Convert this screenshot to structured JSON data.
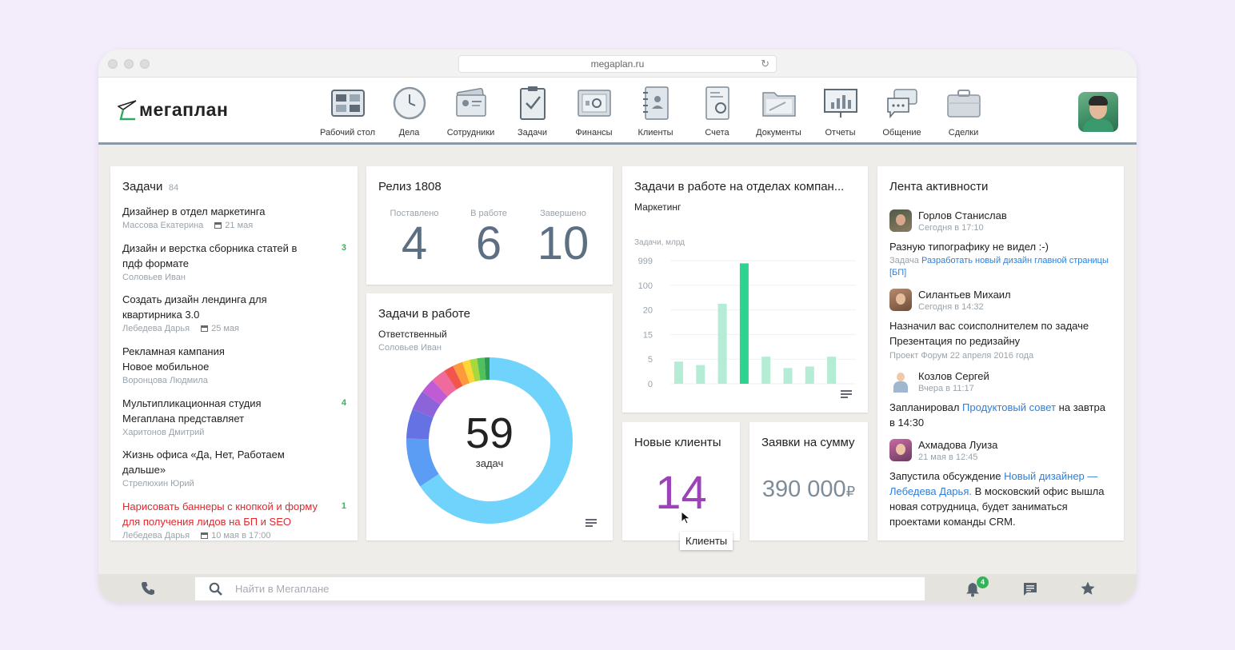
{
  "browser": {
    "url": "megaplan.ru"
  },
  "app": {
    "logo_text": "мегаплан",
    "brand_color": "#2ea866"
  },
  "nav": [
    {
      "label": "Рабочий стол",
      "icon": "desktop-icon"
    },
    {
      "label": "Дела",
      "icon": "clock-icon"
    },
    {
      "label": "Сотрудники",
      "icon": "employees-icon"
    },
    {
      "label": "Задачи",
      "icon": "task-clipboard-icon"
    },
    {
      "label": "Финансы",
      "icon": "safe-icon"
    },
    {
      "label": "Клиенты",
      "icon": "client-notebook-icon"
    },
    {
      "label": "Счета",
      "icon": "invoice-icon"
    },
    {
      "label": "Документы",
      "icon": "folder-icon"
    },
    {
      "label": "Отчеты",
      "icon": "report-board-icon"
    },
    {
      "label": "Общение",
      "icon": "chat-bubbles-icon"
    },
    {
      "label": "Сделки",
      "icon": "briefcase-icon"
    }
  ],
  "tasks": {
    "title": "Задачи",
    "count": "84",
    "items": [
      {
        "title": "Дизайнер в отдел маркетинга",
        "person": "Массова Екатерина",
        "date": "21 мая",
        "counter": ""
      },
      {
        "title": "Дизайн и верстка сборника статей в пдф формате",
        "person": "Соловьев Иван",
        "date": "",
        "counter": "3"
      },
      {
        "title": "Создать дизайн лендинга для квартирника 3.0",
        "person": "Лебедева Дарья",
        "date": "25 мая",
        "counter": ""
      },
      {
        "title": "Рекламная кампания Новое мобильное",
        "person": "Воронцова Людмила",
        "date": "",
        "counter": ""
      },
      {
        "title": "Мультипликационная студия Мегаплана представляет",
        "person": "Харитонов Дмитрий",
        "date": "",
        "counter": "4"
      },
      {
        "title": "Жизнь офиса «Да, Нет, Работаем дальше»",
        "person": "Стрелюхин Юрий",
        "date": "",
        "counter": ""
      },
      {
        "title": "Нарисовать баннеры с кнопкой и форму для получения лидов на БП и SEO",
        "person": "Лебедева Дарья",
        "date": "10 мая в 17:00",
        "counter": "1",
        "overdue": true
      }
    ]
  },
  "release": {
    "title": "Релиз 1808",
    "stats": [
      {
        "label": "Поставлено",
        "value": "4"
      },
      {
        "label": "В работе",
        "value": "6"
      },
      {
        "label": "Завершено",
        "value": "10"
      }
    ]
  },
  "in_progress": {
    "title": "Задачи в работе",
    "subtitle": "Ответственный",
    "person": "Соловьев Иван",
    "total": "59",
    "total_label": "задач"
  },
  "departments": {
    "title": "Задачи в работе на отделах компан...",
    "subtitle": "Маркетинг"
  },
  "chart_data": {
    "type": "bar",
    "ylabel": "Задачи, млрд",
    "yticks": [
      "999",
      "100",
      "20",
      "15",
      "5",
      "0"
    ],
    "categories": [
      "",
      "",
      "",
      "",
      "",
      "",
      "",
      ""
    ],
    "values": [
      4.5,
      3.8,
      40,
      900,
      6,
      3.2,
      3.5,
      6
    ],
    "highlight_index": 3,
    "bar_color": "#b4ecd6",
    "highlight_color": "#2dd48f"
  },
  "donut": {
    "segments": [
      {
        "value": 0.68,
        "color": "#6fd3fb"
      },
      {
        "value": 0.1,
        "color": "#5b9cf5"
      },
      {
        "value": 0.06,
        "color": "#6572e3"
      },
      {
        "value": 0.04,
        "color": "#8d63d9"
      },
      {
        "value": 0.03,
        "color": "#c05bd6"
      },
      {
        "value": 0.03,
        "color": "#ef6b9d"
      },
      {
        "value": 0.02,
        "color": "#f2554d"
      },
      {
        "value": 0.02,
        "color": "#ff9a3c"
      },
      {
        "value": 0.015,
        "color": "#ffd633"
      },
      {
        "value": 0.015,
        "color": "#a8d93c"
      },
      {
        "value": 0.015,
        "color": "#4fc15f"
      },
      {
        "value": 0.01,
        "color": "#2e9a4f"
      }
    ]
  },
  "new_clients": {
    "title": "Новые клиенты",
    "value": "14",
    "value_color": "#9b44b8",
    "tooltip": "Клиенты"
  },
  "requests": {
    "title": "Заявки на сумму",
    "value": "390 000",
    "currency": "₽"
  },
  "feed": {
    "title": "Лента активности",
    "items": [
      {
        "name": "Горлов Станислав",
        "time": "Сегодня в 17:10",
        "text": "Разную типографику не видел :-)",
        "sub_prefix": "Задача",
        "sub_link": "Разработать новый дизайн главной страницы [БП]"
      },
      {
        "name": "Силантьев Михаил",
        "time": "Сегодня в 14:32",
        "text": "Назначил вас соисполнителем по задаче",
        "link": "Презентация по редизайну",
        "sub": "Проект Форум 22 апреля 2016 года"
      },
      {
        "name": "Козлов Сергей",
        "time": "Вчера в 11:17",
        "text_before": "Запланировал",
        "link": "Продуктовый совет",
        "text_after": "на завтра в 14:30"
      },
      {
        "name": "Ахмадова Луиза",
        "time": "21 мая в 12:45",
        "text_before": "Запустила обсуждение",
        "link": "Новый дизайнер — Лебедева Дарья.",
        "text_after": "В московский офис вышла новая сотрудница, будет заниматься проектами команды CRM."
      }
    ]
  },
  "bottom": {
    "search_placeholder": "Найти в Мегаплане",
    "notifications": "4"
  }
}
